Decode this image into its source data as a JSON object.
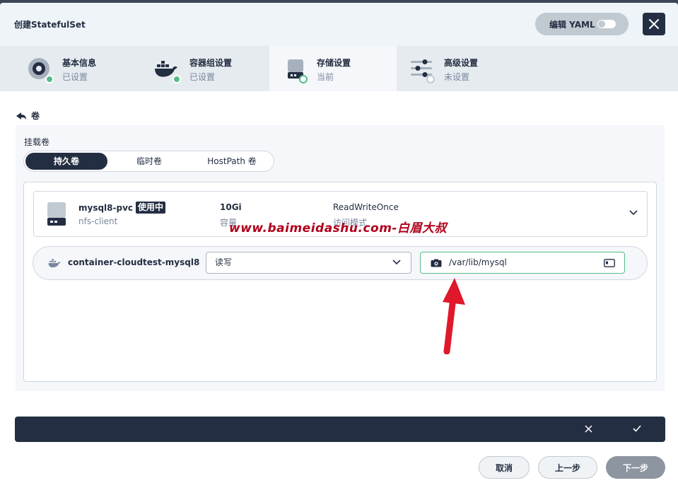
{
  "modal": {
    "title": "创建StatefulSet",
    "yaml_label": "编辑 YAML"
  },
  "tabs": [
    {
      "label": "基本信息",
      "status": "已设置",
      "icon": "settings-circle-icon",
      "status_color": "#55bc8a"
    },
    {
      "label": "容器组设置",
      "status": "已设置",
      "icon": "docker-whale-icon",
      "status_color": "#55bc8a"
    },
    {
      "label": "存储设置",
      "status": "当前",
      "icon": "disk-icon",
      "status_color": "#ffffff"
    },
    {
      "label": "高级设置",
      "status": "未设置",
      "icon": "sliders-icon",
      "status_color": "#ffffff"
    }
  ],
  "volumes": {
    "back_label": "卷",
    "mount_label": "挂载卷",
    "types": [
      "持久卷",
      "临时卷",
      "HostPath 卷"
    ],
    "selected_type": "持久卷"
  },
  "pvc": {
    "name": "mysql8-pvc",
    "badge": "使用中",
    "storage_class": "nfs-client",
    "capacity_value": "10Gi",
    "capacity_label": "容量",
    "access_mode_value": "ReadWriteOnce",
    "access_mode_label": "访问模式"
  },
  "watermark": "www.baimeidashu.com-白眉大叔",
  "mount": {
    "container": "container-cloudtest-mysql8",
    "mode": "读写",
    "path": "/var/lib/mysql"
  },
  "buttons": {
    "cancel": "取消",
    "prev": "上一步",
    "next": "下一步"
  },
  "colors": {
    "primary": "#242e42",
    "success": "#55bc8a",
    "annotation": "#e0182b"
  }
}
